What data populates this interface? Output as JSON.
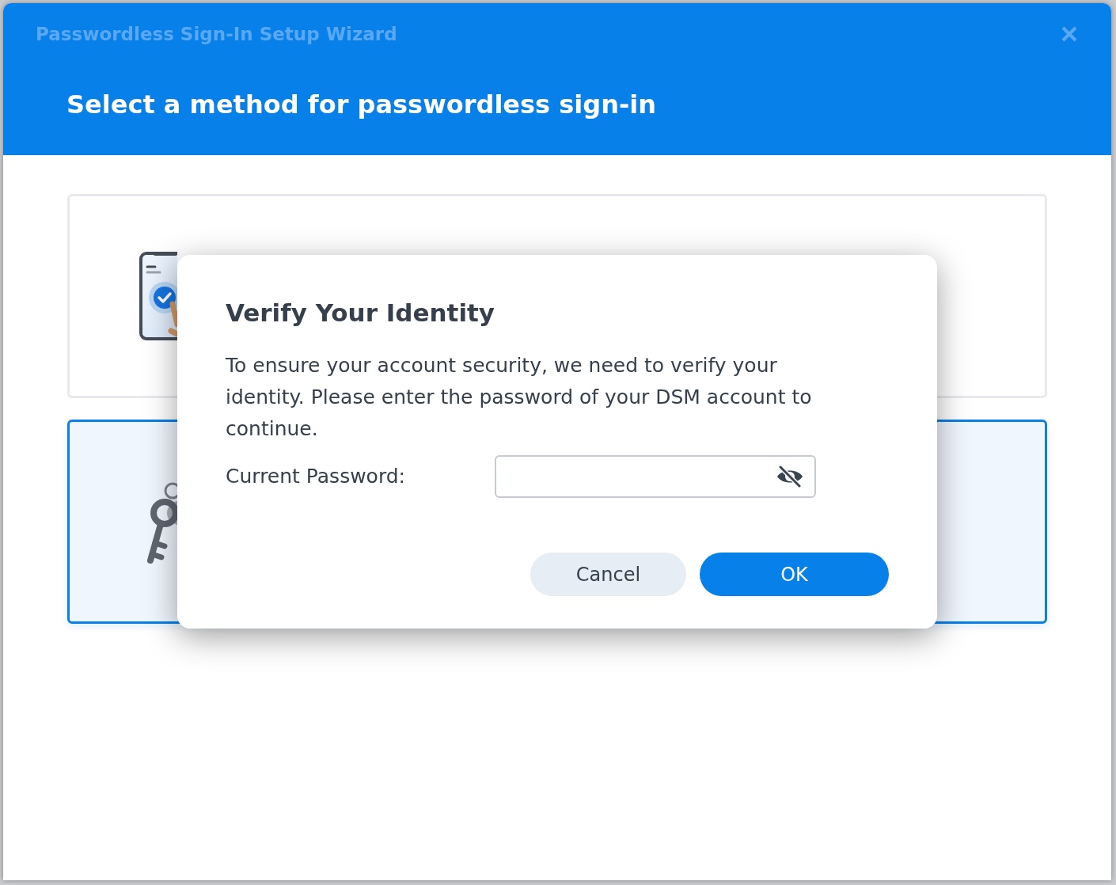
{
  "wizard": {
    "title": "Passwordless Sign-In Setup Wizard",
    "heading": "Select a method for passwordless sign-in",
    "options": [
      {
        "kind": "phone",
        "selected": false
      },
      {
        "kind": "key",
        "selected": true
      }
    ]
  },
  "dialog": {
    "title": "Verify Your Identity",
    "message": "To ensure your account security, we need to verify your identity. Please enter the password of your DSM account to continue.",
    "field": {
      "label": "Current Password:"
    },
    "buttons": [
      {
        "label": "Cancel",
        "kind": "secondary"
      },
      {
        "label": "OK",
        "kind": "primary"
      }
    ]
  }
}
